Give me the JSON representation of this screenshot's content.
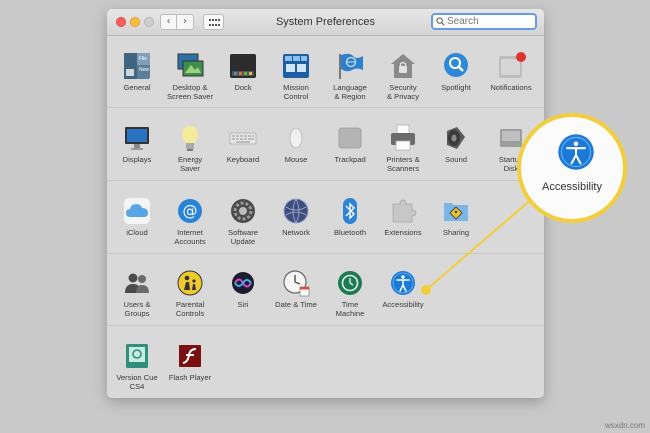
{
  "window": {
    "title": "System Preferences",
    "search_placeholder": "Search",
    "back_icon": "chevron-left-icon",
    "forward_icon": "chevron-right-icon",
    "grid_icon": "grid-icon"
  },
  "rows": [
    [
      {
        "label": "General",
        "icon": "general-icon"
      },
      {
        "label": "Desktop &\nScreen Saver",
        "icon": "desktop-icon"
      },
      {
        "label": "Dock",
        "icon": "dock-icon"
      },
      {
        "label": "Mission\nControl",
        "icon": "mission-control-icon"
      },
      {
        "label": "Language\n& Region",
        "icon": "flag-icon"
      },
      {
        "label": "Security\n& Privacy",
        "icon": "house-lock-icon"
      },
      {
        "label": "Spotlight",
        "icon": "magnifier-icon"
      },
      {
        "label": "Notifications",
        "icon": "notifications-icon"
      }
    ],
    [
      {
        "label": "Displays",
        "icon": "monitor-icon"
      },
      {
        "label": "Energy\nSaver",
        "icon": "lightbulb-icon"
      },
      {
        "label": "Keyboard",
        "icon": "keyboard-icon"
      },
      {
        "label": "Mouse",
        "icon": "mouse-icon"
      },
      {
        "label": "Trackpad",
        "icon": "trackpad-icon"
      },
      {
        "label": "Printers &\nScanners",
        "icon": "printer-icon"
      },
      {
        "label": "Sound",
        "icon": "speaker-icon"
      },
      {
        "label": "Startup\nDisk",
        "icon": "disk-icon"
      }
    ],
    [
      {
        "label": "iCloud",
        "icon": "cloud-icon"
      },
      {
        "label": "Internet\nAccounts",
        "icon": "at-icon"
      },
      {
        "label": "Software\nUpdate",
        "icon": "gear-icon"
      },
      {
        "label": "Network",
        "icon": "globe-icon"
      },
      {
        "label": "Bluetooth",
        "icon": "bluetooth-icon"
      },
      {
        "label": "Extensions",
        "icon": "puzzle-icon"
      },
      {
        "label": "Sharing",
        "icon": "folder-sign-icon"
      }
    ],
    [
      {
        "label": "Users &\nGroups",
        "icon": "users-icon"
      },
      {
        "label": "Parental\nControls",
        "icon": "parental-icon"
      },
      {
        "label": "Siri",
        "icon": "siri-icon"
      },
      {
        "label": "Date & Time",
        "icon": "clock-icon"
      },
      {
        "label": "Time\nMachine",
        "icon": "time-machine-icon"
      },
      {
        "label": "Accessibility",
        "icon": "accessibility-icon"
      }
    ],
    [
      {
        "label": "Version Cue\nCS4",
        "icon": "version-cue-icon"
      },
      {
        "label": "Flash Player",
        "icon": "flash-icon"
      }
    ]
  ],
  "callout": {
    "label": "Accessibility",
    "icon": "accessibility-icon",
    "color": "#f3ce3c"
  },
  "watermark": "wsxdn.com"
}
